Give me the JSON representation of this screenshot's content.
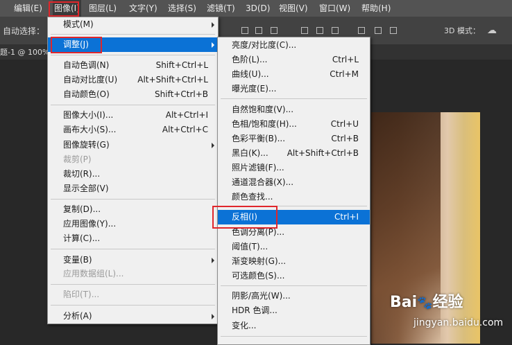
{
  "menubar": {
    "items": [
      "编辑(E)",
      "图像(I)",
      "图层(L)",
      "文字(Y)",
      "选择(S)",
      "滤镜(T)",
      "3D(D)",
      "视图(V)",
      "窗口(W)",
      "帮助(H)"
    ]
  },
  "options": {
    "auto_select_label": "自动选择：",
    "mode_3d_label": "3D 模式："
  },
  "doc_tab": {
    "label": "题-1 @ 100%"
  },
  "image_menu": {
    "items": [
      {
        "label": "模式(M)",
        "shortcut": ""
      },
      {
        "label": "调整(J)",
        "shortcut": ""
      },
      {
        "label": "自动色调(N)",
        "shortcut": "Shift+Ctrl+L"
      },
      {
        "label": "自动对比度(U)",
        "shortcut": "Alt+Shift+Ctrl+L"
      },
      {
        "label": "自动颜色(O)",
        "shortcut": "Shift+Ctrl+B"
      },
      {
        "label": "图像大小(I)...",
        "shortcut": "Alt+Ctrl+I"
      },
      {
        "label": "画布大小(S)...",
        "shortcut": "Alt+Ctrl+C"
      },
      {
        "label": "图像旋转(G)",
        "shortcut": ""
      },
      {
        "label": "裁剪(P)",
        "shortcut": ""
      },
      {
        "label": "裁切(R)...",
        "shortcut": ""
      },
      {
        "label": "显示全部(V)",
        "shortcut": ""
      },
      {
        "label": "复制(D)...",
        "shortcut": ""
      },
      {
        "label": "应用图像(Y)...",
        "shortcut": ""
      },
      {
        "label": "计算(C)...",
        "shortcut": ""
      },
      {
        "label": "变量(B)",
        "shortcut": ""
      },
      {
        "label": "应用数据组(L)...",
        "shortcut": ""
      },
      {
        "label": "陷印(T)...",
        "shortcut": ""
      },
      {
        "label": "分析(A)",
        "shortcut": ""
      }
    ]
  },
  "adjust_menu": {
    "items": [
      {
        "label": "亮度/对比度(C)...",
        "shortcut": ""
      },
      {
        "label": "色阶(L)...",
        "shortcut": "Ctrl+L"
      },
      {
        "label": "曲线(U)...",
        "shortcut": "Ctrl+M"
      },
      {
        "label": "曝光度(E)...",
        "shortcut": ""
      },
      {
        "label": "自然饱和度(V)...",
        "shortcut": ""
      },
      {
        "label": "色相/饱和度(H)...",
        "shortcut": "Ctrl+U"
      },
      {
        "label": "色彩平衡(B)...",
        "shortcut": "Ctrl+B"
      },
      {
        "label": "黑白(K)...",
        "shortcut": "Alt+Shift+Ctrl+B"
      },
      {
        "label": "照片滤镜(F)...",
        "shortcut": ""
      },
      {
        "label": "通道混合器(X)...",
        "shortcut": ""
      },
      {
        "label": "颜色查找...",
        "shortcut": ""
      },
      {
        "label": "反相(I)",
        "shortcut": "Ctrl+I"
      },
      {
        "label": "色调分离(P)...",
        "shortcut": ""
      },
      {
        "label": "阈值(T)...",
        "shortcut": ""
      },
      {
        "label": "渐变映射(G)...",
        "shortcut": ""
      },
      {
        "label": "可选颜色(S)...",
        "shortcut": ""
      },
      {
        "label": "阴影/高光(W)...",
        "shortcut": ""
      },
      {
        "label": "HDR 色调...",
        "shortcut": ""
      },
      {
        "label": "变化...",
        "shortcut": ""
      }
    ]
  },
  "watermark": {
    "brand": "Bai",
    "brand2": "经验",
    "url": "jingyan.baidu.com"
  },
  "colors": {
    "highlight": "#0b72d6",
    "annotation": "#e0262b"
  }
}
